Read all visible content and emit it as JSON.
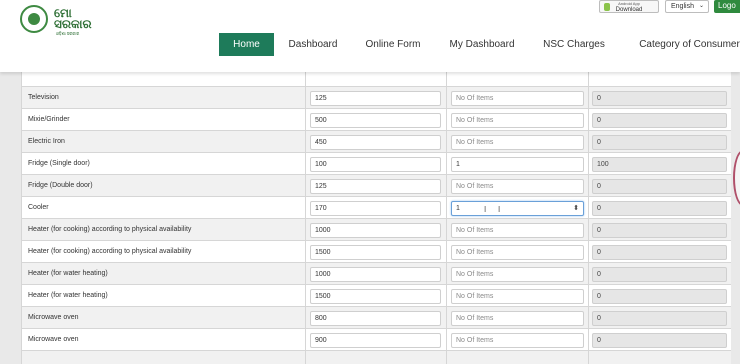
{
  "header": {
    "logo_text_line1": "ମୋ",
    "logo_text_line2": "ସରକାର",
    "logo_sub": "ଓଡ଼ିଶା ସରକାର",
    "app_download_small": "Android App",
    "app_download_label": "Download",
    "language": "English",
    "logout_label": "Logo"
  },
  "nav": {
    "items": [
      {
        "label": "Home"
      },
      {
        "label": "Dashboard"
      },
      {
        "label": "Online Form"
      },
      {
        "label": "My Dashboard"
      },
      {
        "label": "NSC Charges"
      },
      {
        "label": "Category of Consumers"
      }
    ]
  },
  "table": {
    "qty_placeholder": "No Of Items",
    "rows": [
      {
        "name": "Television",
        "wattage": "125",
        "quantity": "",
        "total": "0"
      },
      {
        "name": "Mixie/Grinder",
        "wattage": "500",
        "quantity": "",
        "total": "0"
      },
      {
        "name": "Electric Iron",
        "wattage": "450",
        "quantity": "",
        "total": "0"
      },
      {
        "name": "Fridge (Single door)",
        "wattage": "100",
        "quantity": "1",
        "total": "100"
      },
      {
        "name": "Fridge (Double door)",
        "wattage": "125",
        "quantity": "",
        "total": "0"
      },
      {
        "name": "Cooler",
        "wattage": "170",
        "quantity": "1",
        "total": "0"
      },
      {
        "name": "Heater (for cooking) according to physical availability",
        "wattage": "1000",
        "quantity": "",
        "total": "0"
      },
      {
        "name": "Heater (for cooking) according to physical availability",
        "wattage": "1500",
        "quantity": "",
        "total": "0"
      },
      {
        "name": "Heater (for water heating)",
        "wattage": "1000",
        "quantity": "",
        "total": "0"
      },
      {
        "name": "Heater (for water heating)",
        "wattage": "1500",
        "quantity": "",
        "total": "0"
      },
      {
        "name": "Microwave oven",
        "wattage": "800",
        "quantity": "",
        "total": "0"
      },
      {
        "name": "Microwave oven",
        "wattage": "900",
        "quantity": "",
        "total": "0"
      }
    ]
  }
}
